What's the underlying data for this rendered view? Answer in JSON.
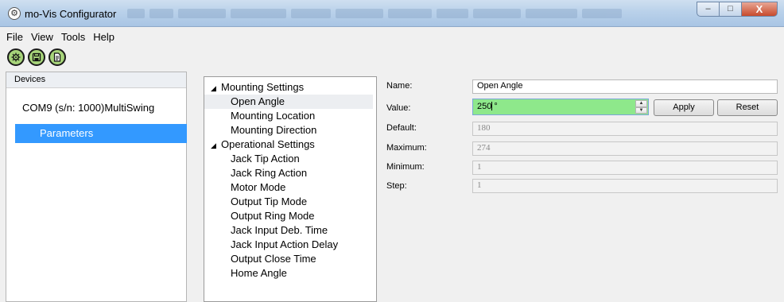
{
  "window": {
    "title": "mo-Vis Configurator",
    "minimize": "–",
    "maximize": "□",
    "close": "X"
  },
  "menu": [
    "File",
    "View",
    "Tools",
    "Help"
  ],
  "toolbar": {
    "icons": [
      "connect-gear-icon",
      "save-icon",
      "document-icon"
    ]
  },
  "devices": {
    "header": "Devices",
    "device": "COM9 (s/n: 1000)MultiSwing",
    "parameters": "Parameters"
  },
  "tree": [
    {
      "label": "Mounting Settings",
      "children": [
        "Open Angle",
        "Mounting Location",
        "Mounting Direction"
      ]
    },
    {
      "label": "Operational Settings",
      "children": [
        "Jack Tip Action",
        "Jack Ring Action",
        "Motor Mode",
        "Output Tip Mode",
        "Output Ring Mode",
        "Jack Input Deb. Time",
        "Jack Input Action Delay",
        "Output Close Time",
        "Home Angle"
      ]
    }
  ],
  "selected_item": "Open Angle",
  "props": {
    "name_label": "Name:",
    "name_value": "Open Angle",
    "value_label": "Value:",
    "value": "250",
    "unit": "°",
    "apply": "Apply",
    "reset": "Reset",
    "default_label": "Default:",
    "default_value": "180",
    "maximum_label": "Maximum:",
    "maximum_value": "274",
    "minimum_label": "Minimum:",
    "minimum_value": "1",
    "step_label": "Step:",
    "step_value": "1"
  },
  "colors": {
    "selection": "#3399ff",
    "value_valid": "#8ee88b",
    "toolbar_icon": "#a7d47a"
  }
}
